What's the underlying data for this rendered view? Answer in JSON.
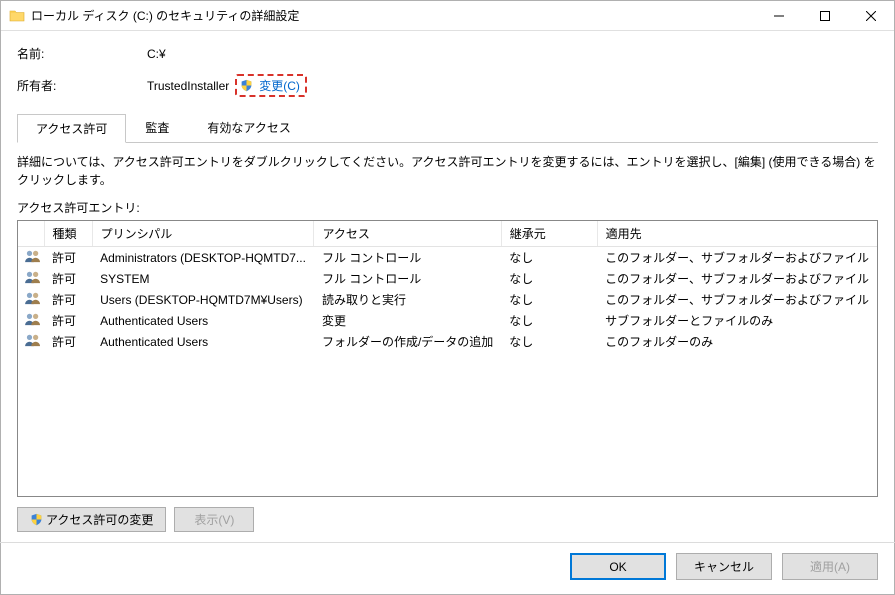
{
  "window": {
    "title": "ローカル ディスク (C:) のセキュリティの詳細設定"
  },
  "name": {
    "label": "名前:",
    "value": "C:¥"
  },
  "owner": {
    "label": "所有者:",
    "value": "TrustedInstaller",
    "change_label": "変更(C)"
  },
  "tabs": [
    {
      "id": "perm",
      "label": "アクセス許可",
      "active": true
    },
    {
      "id": "audit",
      "label": "監査",
      "active": false
    },
    {
      "id": "effective",
      "label": "有効なアクセス",
      "active": false
    }
  ],
  "instruction": "詳細については、アクセス許可エントリをダブルクリックしてください。アクセス許可エントリを変更するには、エントリを選択し、[編集] (使用できる場合) をクリックします。",
  "entries_label": "アクセス許可エントリ:",
  "columns": {
    "type": "種類",
    "principal": "プリンシパル",
    "access": "アクセス",
    "inherited": "継承元",
    "applies": "適用先"
  },
  "entries": [
    {
      "type": "許可",
      "principal": "Administrators (DESKTOP-HQMTD7...",
      "access": "フル コントロール",
      "inherited": "なし",
      "applies": "このフォルダー、サブフォルダーおよびファイル"
    },
    {
      "type": "許可",
      "principal": "SYSTEM",
      "access": "フル コントロール",
      "inherited": "なし",
      "applies": "このフォルダー、サブフォルダーおよびファイル"
    },
    {
      "type": "許可",
      "principal": "Users (DESKTOP-HQMTD7M¥Users)",
      "access": "読み取りと実行",
      "inherited": "なし",
      "applies": "このフォルダー、サブフォルダーおよびファイル"
    },
    {
      "type": "許可",
      "principal": "Authenticated Users",
      "access": "変更",
      "inherited": "なし",
      "applies": "サブフォルダーとファイルのみ"
    },
    {
      "type": "許可",
      "principal": "Authenticated Users",
      "access": "フォルダーの作成/データの追加",
      "inherited": "なし",
      "applies": "このフォルダーのみ"
    }
  ],
  "actions": {
    "change_permissions": "アクセス許可の変更",
    "view": "表示(V)"
  },
  "footer": {
    "ok": "OK",
    "cancel": "キャンセル",
    "apply": "適用(A)"
  }
}
